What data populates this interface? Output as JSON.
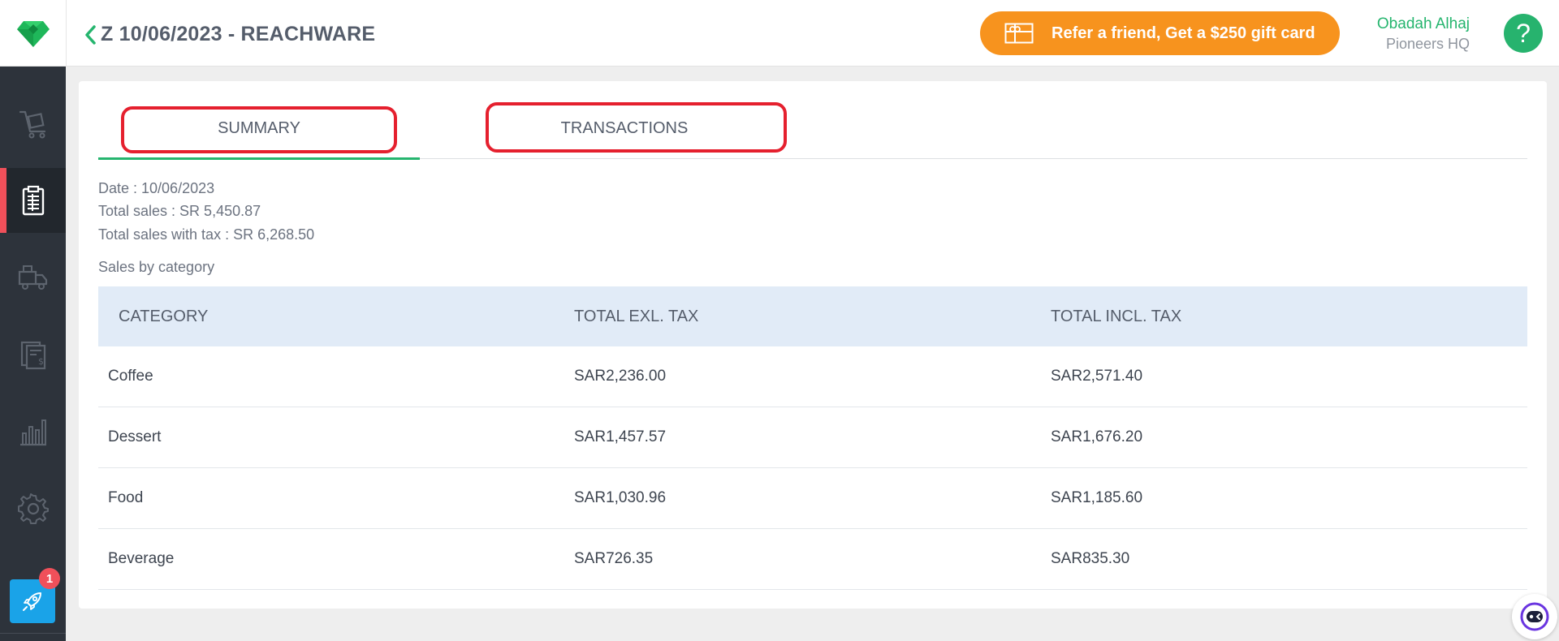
{
  "header": {
    "title": "Z 10/06/2023 - REACHWARE",
    "refer_label": "Refer a friend, Get a $250 gift card",
    "user_name": "Obadah Alhaj",
    "user_org": "Pioneers HQ",
    "help_label": "?"
  },
  "sidebar": {
    "items": [
      {
        "icon": "cart-icon"
      },
      {
        "icon": "clipboard-icon",
        "active": true
      },
      {
        "icon": "delivery-truck-icon"
      },
      {
        "icon": "invoice-icon"
      },
      {
        "icon": "bar-chart-icon"
      },
      {
        "icon": "gear-icon"
      }
    ],
    "notification_count": "1"
  },
  "tabs": {
    "summary": "SUMMARY",
    "transactions": "TRANSACTIONS"
  },
  "summary": {
    "date": "Date : 10/06/2023",
    "total_sales": "Total sales : SR 5,450.87",
    "total_sales_tax": "Total sales with tax : SR 6,268.50",
    "section_title": "Sales by category"
  },
  "table": {
    "headers": [
      "CATEGORY",
      "TOTAL EXL. TAX",
      "TOTAL INCL. TAX"
    ],
    "rows": [
      [
        "Coffee",
        "SAR2,236.00",
        "SAR2,571.40"
      ],
      [
        "Dessert",
        "SAR1,457.57",
        "SAR1,676.20"
      ],
      [
        "Food",
        "SAR1,030.96",
        "SAR1,185.60"
      ],
      [
        "Beverage",
        "SAR726.35",
        "SAR835.30"
      ]
    ]
  },
  "colors": {
    "brand_green": "#25b56e",
    "refer_orange": "#f7931e",
    "active_accent": "#f0505a",
    "highlight_red": "#e5202e",
    "sidebar_bg": "#2d333b"
  }
}
